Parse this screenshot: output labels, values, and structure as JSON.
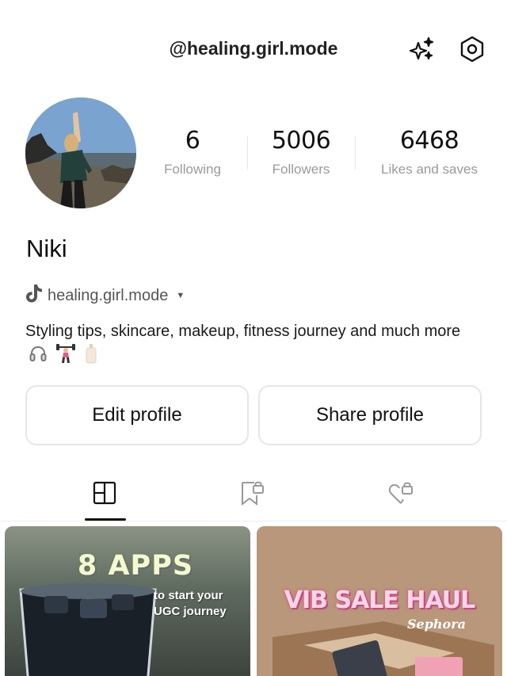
{
  "header": {
    "handle_title": "@healing.girl.mode"
  },
  "stats": [
    {
      "value": "6",
      "label": "Following"
    },
    {
      "value": "5006",
      "label": "Followers"
    },
    {
      "value": "6468",
      "label": "Likes and saves"
    }
  ],
  "profile": {
    "name": "Niki",
    "tiktok_handle": "healing.girl.mode",
    "bio": "Styling tips, skincare, makeup, fitness journey and much more"
  },
  "buttons": {
    "edit": "Edit profile",
    "share": "Share profile"
  },
  "tabs": [
    {
      "icon": "grid-icon",
      "active": true
    },
    {
      "icon": "bookmark-lock-icon",
      "active": false
    },
    {
      "icon": "heart-lock-icon",
      "active": false
    }
  ],
  "posts": [
    {
      "title": "8 APPS",
      "subtitle": "to start your UGC journey"
    },
    {
      "title": "VIB SALE HAUL",
      "subtitle": "Sephora"
    }
  ]
}
